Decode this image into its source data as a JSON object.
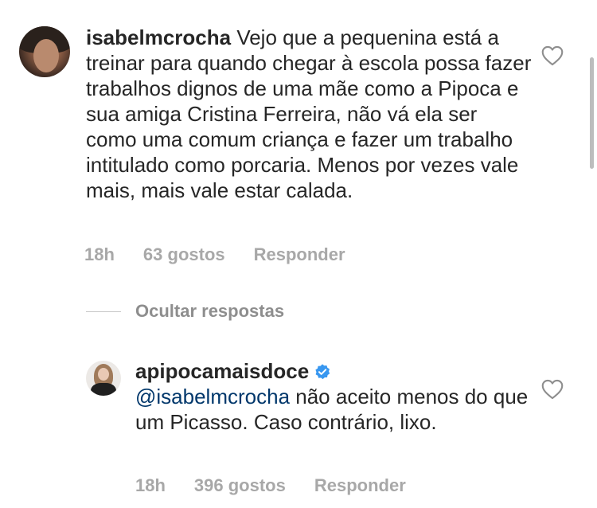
{
  "comment": {
    "username": "isabelmcrocha",
    "text": " Vejo que a pequenina está a treinar para quando chegar à escola possa fazer trabalhos dignos de uma mãe como a Pipoca e sua amiga Cristina Ferreira, não vá ela ser como uma comum criança e fazer um trabalho intitulado como porcaria. Menos por vezes vale mais, mais vale estar calada.",
    "time": "18h",
    "likes": "63 gostos",
    "reply_label": "Responder"
  },
  "replies_toggle": {
    "label": "Ocultar respostas"
  },
  "reply": {
    "username": "apipocamaisdoce",
    "verified": true,
    "mention": "@isabelmcrocha",
    "text": " não aceito menos do que um Picasso.  Caso contrário, lixo.",
    "time": "18h",
    "likes": "396 gostos",
    "reply_label": "Responder"
  },
  "icons": {
    "like": "heart-outline-icon",
    "verified": "verified-badge-icon"
  },
  "colors": {
    "text": "#262626",
    "meta": "#a8a8a8",
    "mention": "#00376b",
    "verified": "#3897f0"
  }
}
